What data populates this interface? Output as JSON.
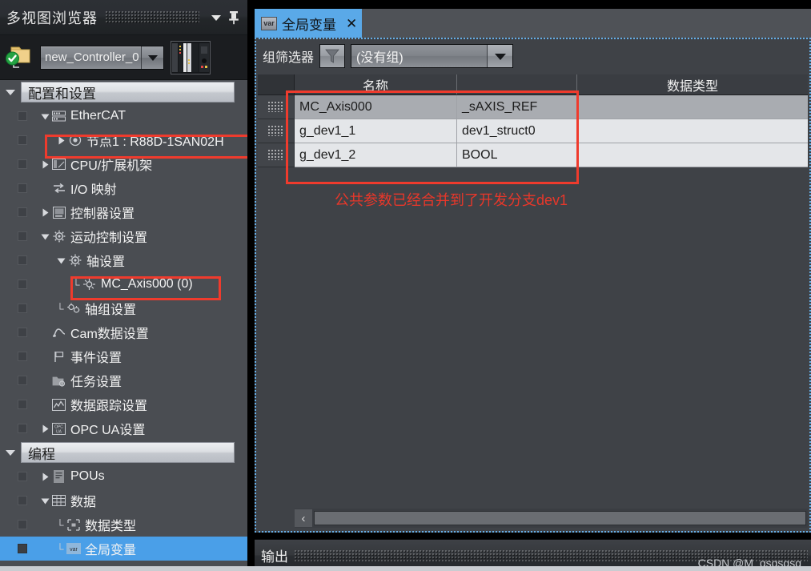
{
  "left_panel": {
    "title": "多视图浏览器",
    "dropdown_icon": "chevron-down-icon",
    "pin_icon": "pin-icon",
    "controller": {
      "name": "new_Controller_0",
      "status_icon": "green-check-icon",
      "folder_icon": "folder-icon",
      "rack_icon": "controller-rack-icon",
      "dropdown_icon": "chevron-down-icon"
    },
    "sections": [
      {
        "label": "配置和设置",
        "expanded": true,
        "items": [
          {
            "label": "EtherCAT",
            "indent": 0,
            "twisty": "down",
            "icon": "ethercat-icon",
            "elbow": false,
            "selected": false
          },
          {
            "label": "节点1 : R88D-1SAN02H",
            "indent": 1,
            "twisty": "right",
            "icon": "node-icon",
            "elbow": false,
            "selected": false
          },
          {
            "label": "CPU/扩展机架",
            "indent": 0,
            "twisty": "right",
            "icon": "rack-icon",
            "elbow": false,
            "selected": false
          },
          {
            "label": "I/O 映射",
            "indent": 0,
            "twisty": "none",
            "icon": "io-map-icon",
            "elbow": false,
            "selected": false
          },
          {
            "label": "控制器设置",
            "indent": 0,
            "twisty": "right",
            "icon": "controller-settings-icon",
            "elbow": false,
            "selected": false
          },
          {
            "label": "运动控制设置",
            "indent": 0,
            "twisty": "down",
            "icon": "gear-icon",
            "elbow": false,
            "selected": false
          },
          {
            "label": "轴设置",
            "indent": 1,
            "twisty": "down",
            "icon": "gear-icon",
            "elbow": false,
            "selected": false
          },
          {
            "label": "MC_Axis000 (0)",
            "indent": 2,
            "twisty": "none",
            "icon": "axis-icon",
            "elbow": true,
            "selected": false
          },
          {
            "label": "轴组设置",
            "indent": 1,
            "twisty": "none",
            "icon": "axis-group-icon",
            "elbow": true,
            "selected": false
          },
          {
            "label": "Cam数据设置",
            "indent": 0,
            "twisty": "none",
            "icon": "cam-icon",
            "elbow": false,
            "selected": false
          },
          {
            "label": "事件设置",
            "indent": 0,
            "twisty": "none",
            "icon": "event-flag-icon",
            "elbow": false,
            "selected": false
          },
          {
            "label": "任务设置",
            "indent": 0,
            "twisty": "none",
            "icon": "task-icon",
            "elbow": false,
            "selected": false
          },
          {
            "label": "数据跟踪设置",
            "indent": 0,
            "twisty": "none",
            "icon": "data-trace-icon",
            "elbow": false,
            "selected": false
          },
          {
            "label": "OPC UA设置",
            "indent": 0,
            "twisty": "right",
            "icon": "opc-ua-icon",
            "elbow": false,
            "selected": false
          }
        ]
      },
      {
        "label": "编程",
        "expanded": true,
        "items": [
          {
            "label": "POUs",
            "indent": 0,
            "twisty": "right",
            "icon": "pou-icon",
            "elbow": false,
            "selected": false
          },
          {
            "label": "数据",
            "indent": 0,
            "twisty": "down",
            "icon": "data-table-icon",
            "elbow": false,
            "selected": false
          },
          {
            "label": "数据类型",
            "indent": 1,
            "twisty": "none",
            "icon": "data-type-icon",
            "elbow": true,
            "selected": false
          },
          {
            "label": "全局变量",
            "indent": 1,
            "twisty": "none",
            "icon": "var-icon",
            "elbow": true,
            "selected": true
          }
        ]
      }
    ]
  },
  "main": {
    "tab": {
      "label": "全局变量",
      "icon": "var-icon",
      "close_icon": "close-icon"
    },
    "toolbar": {
      "filter_label": "组筛选器",
      "filter_icon": "funnel-icon",
      "group_value": "(没有组)",
      "dropdown_icon": "chevron-down-icon"
    },
    "table": {
      "columns": [
        "名称",
        "数据类型"
      ],
      "rows": [
        {
          "name": "MC_Axis000",
          "type": "_sAXIS_REF",
          "selected": true
        },
        {
          "name": "g_dev1_1",
          "type": "dev1_struct0",
          "selected": false
        },
        {
          "name": "g_dev1_2",
          "type": "BOOL",
          "selected": false
        }
      ]
    },
    "annotation": "公共参数已经合并到了开发分支dev1",
    "scrollbar": {
      "left_arrow_icon": "chevron-left-icon"
    }
  },
  "output": {
    "title": "输出",
    "watermark": "CSDN @M_qsqsqsq"
  },
  "colors": {
    "accent_blue": "#5aa9e8",
    "annotation_red": "#ef3b2d",
    "panel_bg": "#4a4d52",
    "grid_row_selected": "#a9acb1",
    "grid_row_normal": "#e4e6e9"
  }
}
